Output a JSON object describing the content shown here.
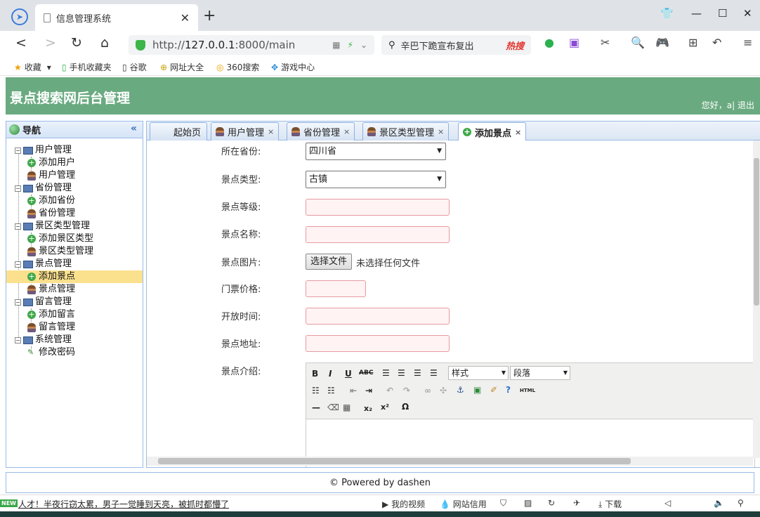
{
  "browser": {
    "tab_title": "信息管理系统",
    "url_prefix": "http://",
    "url_host": "127.0.0.1",
    "url_rest": ":8000/main",
    "search_text": "辛巴下跪宣布复出",
    "search_badge": "热搜",
    "bookmarks": [
      "收藏",
      "手机收藏夹",
      "谷歌",
      "网址大全",
      "360搜索",
      "游戏中心"
    ]
  },
  "app": {
    "title": "景点搜索网后台管理",
    "user_greeting": "您好，a| 退出"
  },
  "sidebar": {
    "title": "导航",
    "groups": [
      {
        "label": "用户管理",
        "items": [
          "添加用户",
          "用户管理"
        ]
      },
      {
        "label": "省份管理",
        "items": [
          "添加省份",
          "省份管理"
        ]
      },
      {
        "label": "景区类型管理",
        "items": [
          "添加景区类型",
          "景区类型管理"
        ]
      },
      {
        "label": "景点管理",
        "items": [
          "添加景点",
          "景点管理"
        ]
      },
      {
        "label": "留言管理",
        "items": [
          "添加留言",
          "留言管理"
        ]
      },
      {
        "label": "系统管理",
        "items": [
          "修改密码"
        ]
      }
    ]
  },
  "tabs": [
    "起始页",
    "用户管理",
    "省份管理",
    "景区类型管理",
    "添加景点"
  ],
  "form": {
    "province_label": "所在省份:",
    "province_value": "四川省",
    "type_label": "景点类型:",
    "type_value": "古镇",
    "level_label": "景点等级:",
    "name_label": "景点名称:",
    "image_label": "景点图片:",
    "file_button": "选择文件",
    "file_status": "未选择任何文件",
    "price_label": "门票价格:",
    "hours_label": "开放时间:",
    "address_label": "景点地址:",
    "intro_label": "景点介绍:",
    "editor_style": "样式",
    "editor_paragraph": "段落"
  },
  "footer": "© Powered by dashen",
  "status": {
    "badge": "NEW",
    "news": "人才！半夜行窃太累，男子一觉睡到天亮，被抓时都懵了",
    "video": "我的视频",
    "credit": "网站信用",
    "download": "下载"
  }
}
